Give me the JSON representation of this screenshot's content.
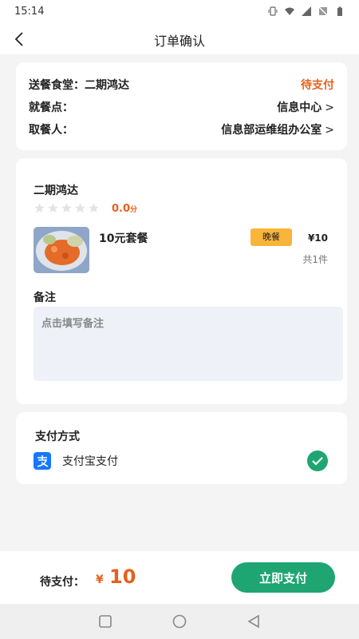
{
  "status_bar": {
    "time": "15:14",
    "icons": [
      "vibrate-icon",
      "wifi-icon",
      "signal-icon",
      "no-sim-icon",
      "battery-icon"
    ]
  },
  "nav": {
    "title": "订单确认",
    "back_icon": "back-arrow-icon"
  },
  "order_info": {
    "canteen_label": "送餐食堂：",
    "canteen_value": "二期鸿达",
    "status": "待支付",
    "dining_point_label": "就餐点：",
    "dining_point_value": "信息中心",
    "receiver_label": "取餐人：",
    "receiver_value": "信息部运维组办公室",
    "chevron": ">"
  },
  "shop": {
    "name": "二期鸿达",
    "rating_stars": 0,
    "rating_max": 5,
    "rating_value": "0.0",
    "rating_unit": "分"
  },
  "dish": {
    "name": "10元套餐",
    "meal_tag": "晚餐",
    "price": "¥10",
    "quantity": "共1件"
  },
  "remark": {
    "label": "备注",
    "placeholder": "点击填写备注",
    "value": ""
  },
  "payment": {
    "title": "支付方式",
    "method": "支付宝支付",
    "selected": true
  },
  "footer": {
    "due_label": "待支付：",
    "currency": "¥",
    "amount": "10",
    "pay_button": "立即支付"
  },
  "colors": {
    "accent_orange": "#e8601c",
    "primary_green": "#1fa572",
    "tag_yellow": "#f9b43a",
    "alipay_blue": "#1677ff"
  }
}
